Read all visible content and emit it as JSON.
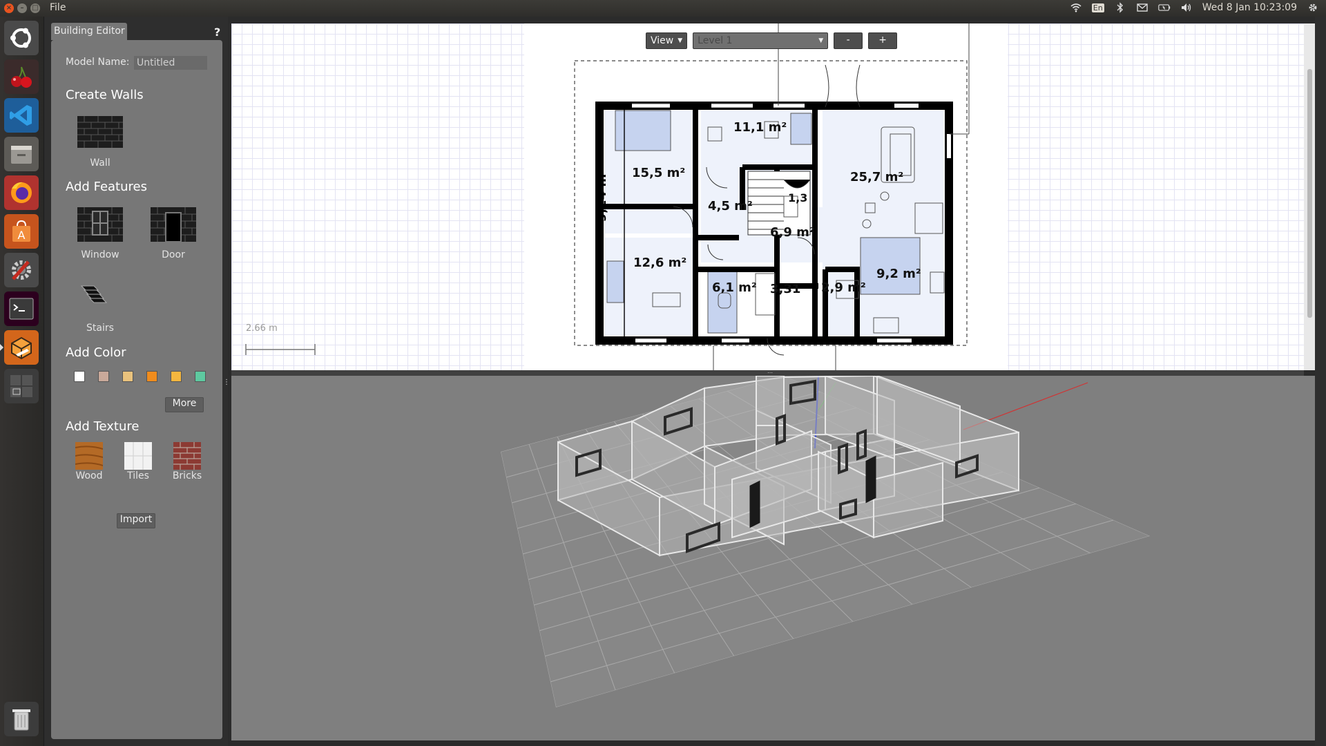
{
  "topbar": {
    "menu_file": "File",
    "keyboard_layout": "En",
    "clock": "Wed 8 Jan 10:23:09",
    "indicator_icons": [
      "wifi-icon",
      "keyboard-icon",
      "bluetooth-icon",
      "mail-icon",
      "battery-icon",
      "volume-icon",
      "gear-icon"
    ]
  },
  "launcher": {
    "apps": [
      "ubuntu-icon",
      "cherry-icon",
      "vscode-icon",
      "files-icon",
      "firefox-icon",
      "software-center-icon",
      "settings-icon",
      "terminal-icon",
      "building-editor-icon",
      "workspace-icon",
      "trash-icon"
    ]
  },
  "editor": {
    "tab_title": "Building Editor",
    "help": "?",
    "model_name_label": "Model Name:",
    "model_name_value": "Untitled",
    "create_walls_heading": "Create Walls",
    "wall_label": "Wall",
    "add_features_heading": "Add Features",
    "window_label": "Window",
    "door_label": "Door",
    "stairs_label": "Stairs",
    "add_color_heading": "Add Color",
    "colors": [
      "#ffffff",
      "#c9a99a",
      "#e9c27d",
      "#f08c1d",
      "#f4b63f",
      "#5ec9a0"
    ],
    "more_button": "More",
    "add_texture_heading": "Add Texture",
    "texture_wood": "Wood",
    "texture_tiles": "Tiles",
    "texture_bricks": "Bricks",
    "import_button": "Import"
  },
  "view2d": {
    "view_button": "View",
    "level_select": "Level 1",
    "zoom_out": "-",
    "zoom_in": "+",
    "scale_label": "2.66 m",
    "dimension_label": "9,24 m",
    "rooms": [
      "15,5 m²",
      "11,1 m²",
      "25,7 m²",
      "4,5 m²",
      "1,3",
      "6,9 m²",
      "12,6 m²",
      "6,1 m²",
      "3,31",
      "2,9 m²",
      "9,2 m²"
    ]
  }
}
